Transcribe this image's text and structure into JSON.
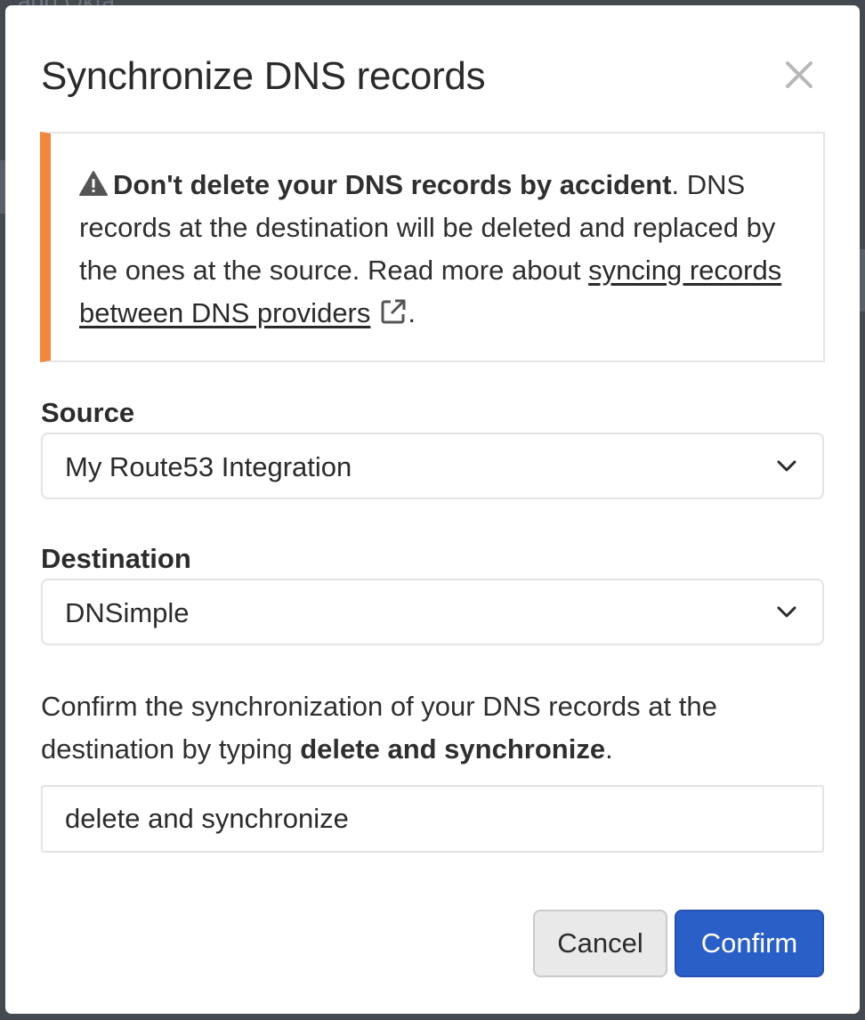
{
  "background": {
    "peek_text": "ado   Okta"
  },
  "modal": {
    "title": "Synchronize DNS records",
    "close_icon": "close-icon",
    "alert": {
      "icon": "warning-icon",
      "bold_text": "Don't delete your DNS records by accident",
      "body_text": ". DNS records at the destination will be deleted and replaced by the ones at the source. Read more about ",
      "link_text": "syncing records between DNS providers",
      "link_icon": "external-link-icon",
      "trailing": ".",
      "accent_color": "#f0883e"
    },
    "source": {
      "label": "Source",
      "value": "My Route53 Integration"
    },
    "destination": {
      "label": "Destination",
      "value": "DNSimple"
    },
    "confirmation": {
      "prefix": "Confirm the synchronization of your DNS records at the destination by typing ",
      "phrase": "delete and synchronize",
      "suffix": ".",
      "input_value": "delete and synchronize"
    },
    "buttons": {
      "cancel_label": "Cancel",
      "confirm_label": "Confirm",
      "confirm_color": "#2b5fc8"
    }
  }
}
